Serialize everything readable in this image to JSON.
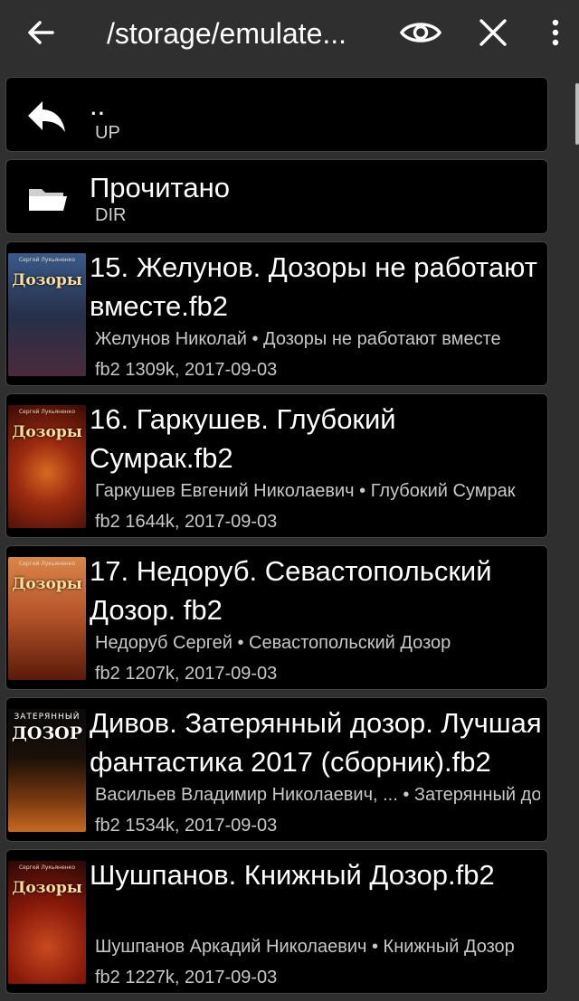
{
  "toolbar": {
    "title": "/storage/emulate..."
  },
  "icons": {
    "back": "arrow-left-icon",
    "eye": "eye-icon",
    "close": "close-icon",
    "menu": "more-vertical-icon",
    "up": "reply-arrow-icon",
    "folder": "folder-icon"
  },
  "items": [
    {
      "name": "..",
      "type_label": "UP"
    },
    {
      "name": "Прочитано",
      "type_label": "DIR"
    }
  ],
  "books": [
    {
      "title": "15. Желунов. Дозоры не работают вместе.fb2",
      "meta": "Желунов Николай • Дозоры не работают вместе",
      "info": "fb2  1309k, 2017-09-03",
      "cover_title": "Дозоры",
      "cover_author": "Сергей Лукьяненко",
      "cover_colors": [
        "#2a4a7a",
        "#4a2a3a"
      ]
    },
    {
      "title": "16. Гаркушев. Глубокий Сумрак.fb2",
      "meta": "Гаркушев Евгений Николаевич • Глубокий Сумрак",
      "info": "fb2  1644k, 2017-09-03",
      "cover_title": "Дозоры",
      "cover_author": "Сергей Лукьяненко",
      "cover_colors": [
        "#9a2a10",
        "#3a0a05"
      ]
    },
    {
      "title": "17. Недоруб. Севастопольский Дозор. fb2",
      "meta": "Недоруб Сергей • Севастопольский Дозор",
      "info": "fb2  1207k, 2017-09-03",
      "cover_title": "Дозоры",
      "cover_author": "Сергей Лукьяненко",
      "cover_colors": [
        "#b8562a",
        "#5a1a0a"
      ]
    },
    {
      "title": "Дивов. Затерянный дозор. Лучшая фантастика 2017 (сборник).fb2",
      "meta": "Васильев Владимир Николаевич, ... • Затерянный дозор. ...",
      "info": "fb2  1534k, 2017-09-03",
      "cover_title": "ДОЗОР",
      "cover_author": "ЗАТЕРЯННЫЙ",
      "cover_colors": [
        "#1a1008",
        "#7a3a10"
      ]
    },
    {
      "title": "Шушпанов. Книжный Дозор.fb2",
      "meta": "Шушпанов Аркадий Николаевич • Книжный Дозор",
      "info": "fb2  1227k, 2017-09-03",
      "cover_title": "Дозоры",
      "cover_author": "Сергей Лукьяненко",
      "cover_colors": [
        "#8a1a0a",
        "#2a0805"
      ]
    }
  ]
}
